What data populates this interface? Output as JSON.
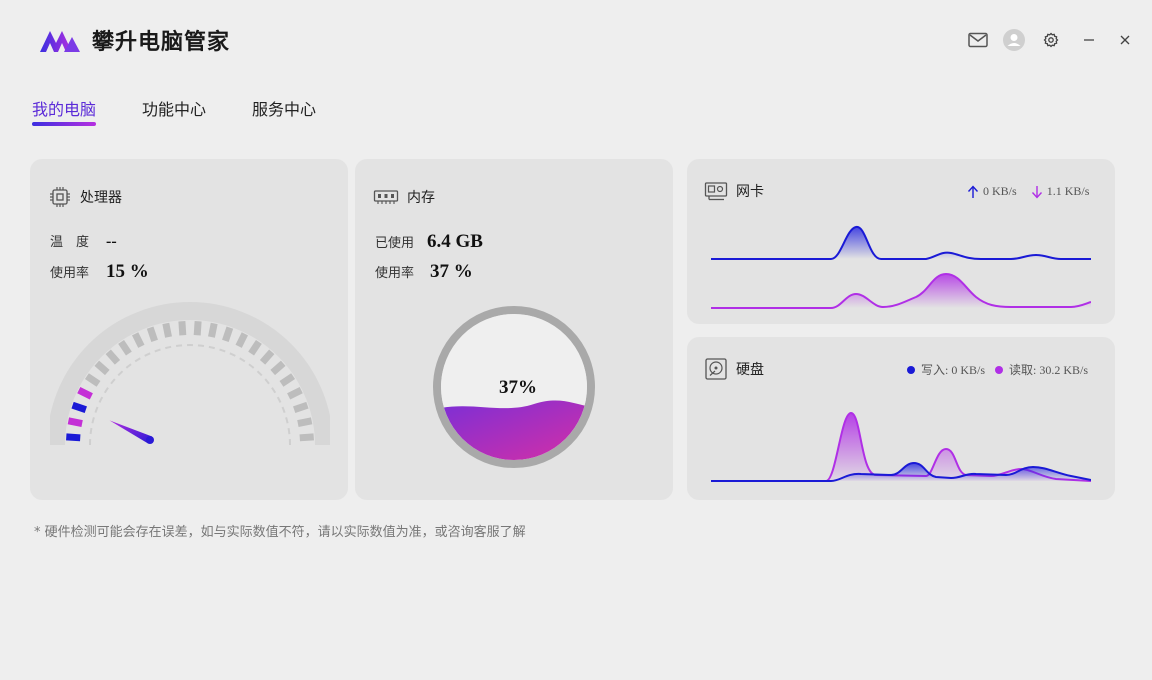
{
  "app": {
    "title": "攀升电脑管家"
  },
  "tabs": [
    {
      "label": "我的电脑",
      "active": true
    },
    {
      "label": "功能中心",
      "active": false
    },
    {
      "label": "服务中心",
      "active": false
    }
  ],
  "cpu": {
    "title": "处理器",
    "temp_label": "温　度",
    "temp_value": "--",
    "usage_label": "使用率",
    "usage_value": "15 %",
    "usage_fraction": 0.15
  },
  "memory": {
    "title": "内存",
    "used_label": "已使用",
    "used_value": "6.4 GB",
    "usage_label": "使用率",
    "usage_value": "37 %",
    "gauge_text": "37%",
    "usage_fraction": 0.37
  },
  "network": {
    "title": "网卡",
    "upload": "0 KB/s",
    "download": "1.1 KB/s",
    "colors": {
      "upload": "#1a1ad6",
      "download": "#b02fe6"
    }
  },
  "disk": {
    "title": "硬盘",
    "write_label": "写入: 0 KB/s",
    "read_label": "读取: 30.2 KB/s",
    "colors": {
      "write": "#1a1ad6",
      "read": "#b02fe6"
    }
  },
  "footnote": "* 硬件检测可能会存在误差，如与实际数值不符，请以实际数值为准，或咨询客服了解"
}
